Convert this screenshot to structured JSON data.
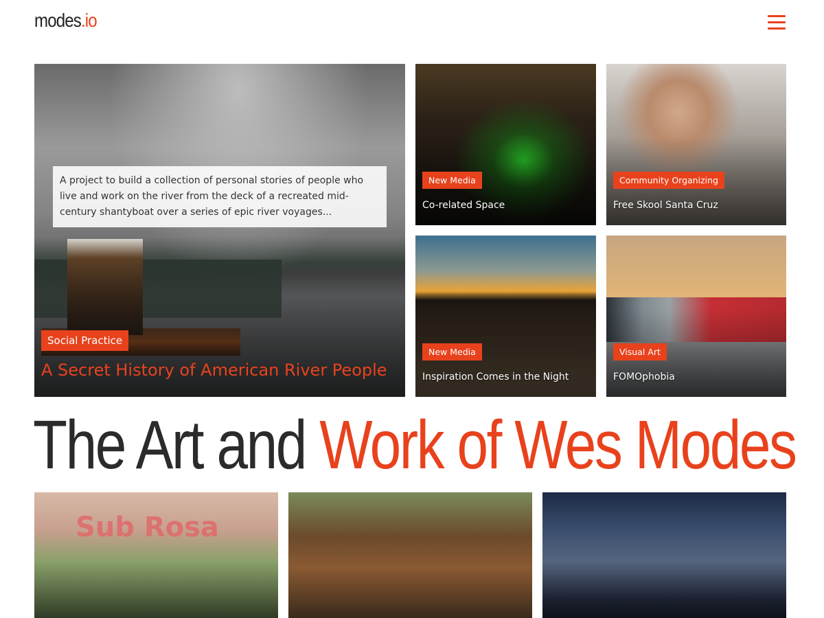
{
  "header": {
    "logo_main": "modes",
    "logo_tld": ".io",
    "menu_icon": "hamburger-menu-icon"
  },
  "colors": {
    "accent": "#e8421d",
    "text_dark": "#2b2b2b"
  },
  "featured": {
    "description": "A project to build a collection of personal stories of people who live and work on the river from the deck of a recreated mid-century shantyboat over a series of epic river voyages...",
    "category": "Social Practice",
    "title": "A Secret History of American River People"
  },
  "tiles": [
    {
      "category": "New Media",
      "title": "Co-related Space"
    },
    {
      "category": "Community Organizing",
      "title": "Free Skool Santa Cruz"
    },
    {
      "category": "New Media",
      "title": "Inspiration Comes in the Night"
    },
    {
      "category": "Visual Art",
      "title": "FOMOphobia"
    }
  ],
  "headline": {
    "part1": "The Art and ",
    "part2": "Work of Wes Modes"
  },
  "bottom_tiles": [
    {
      "sign_text": "Sub Rosa"
    }
  ]
}
